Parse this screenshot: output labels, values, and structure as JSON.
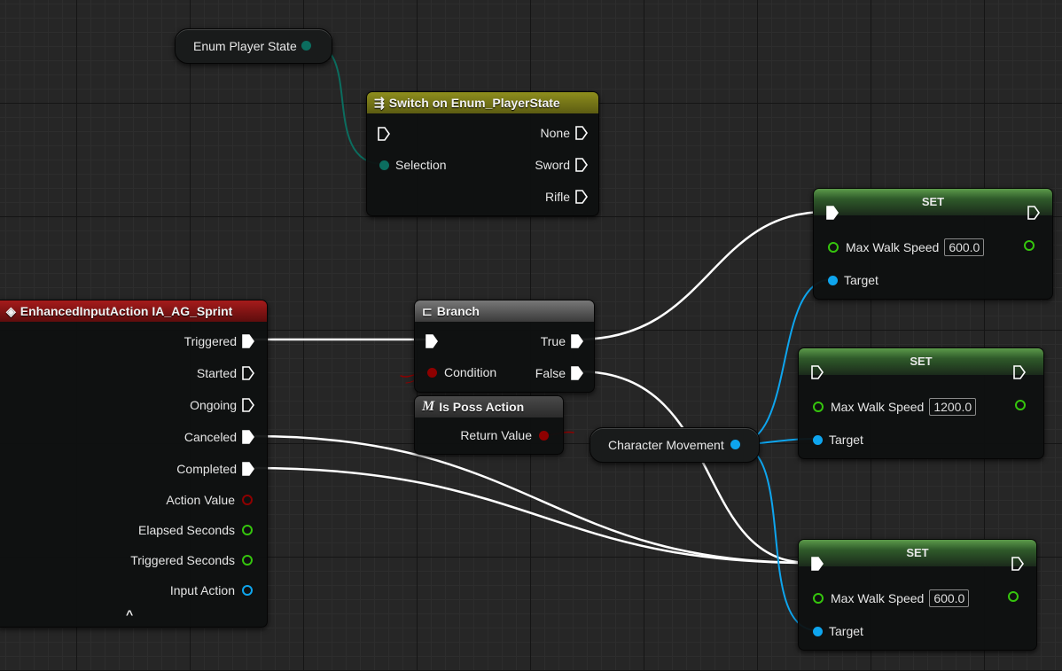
{
  "graph": {
    "enum_getter": {
      "label": "Enum Player State"
    },
    "switch_node": {
      "title": "Switch on Enum_PlayerState",
      "selection_label": "Selection",
      "outputs": [
        "None",
        "Sword",
        "Rifle"
      ]
    },
    "input_event": {
      "title": "EnhancedInputAction IA_AG_Sprint",
      "exec_pins": [
        "Triggered",
        "Started",
        "Ongoing",
        "Canceled",
        "Completed"
      ],
      "data_pins": [
        "Action Value",
        "Elapsed Seconds",
        "Triggered Seconds",
        "Input Action"
      ],
      "collapse_glyph": "^"
    },
    "branch": {
      "title": "Branch",
      "condition_label": "Condition",
      "true_label": "True",
      "false_label": "False"
    },
    "is_poss_action": {
      "icon": "M",
      "title": "Is Poss Action",
      "return_label": "Return Value"
    },
    "character_movement": {
      "label": "Character Movement"
    },
    "set_nodes": [
      {
        "title": "SET",
        "var_label": "Max Walk Speed",
        "value": "600.0",
        "target_label": "Target"
      },
      {
        "title": "SET",
        "var_label": "Max Walk Speed",
        "value": "1200.0",
        "target_label": "Target"
      },
      {
        "title": "SET",
        "var_label": "Max Walk Speed",
        "value": "600.0",
        "target_label": "Target"
      }
    ]
  },
  "colors": {
    "exec_wire": "#ffffff",
    "enum_pin": "#0b6d5f",
    "object_pin": "#0ea5ee",
    "bool_pin": "#8e0000",
    "float_pin": "#35c50d",
    "switch_header": "#7d7d17",
    "event_header": "#8b1414",
    "branch_header": "#5f5f5f",
    "set_header": "#4e8a3e"
  }
}
